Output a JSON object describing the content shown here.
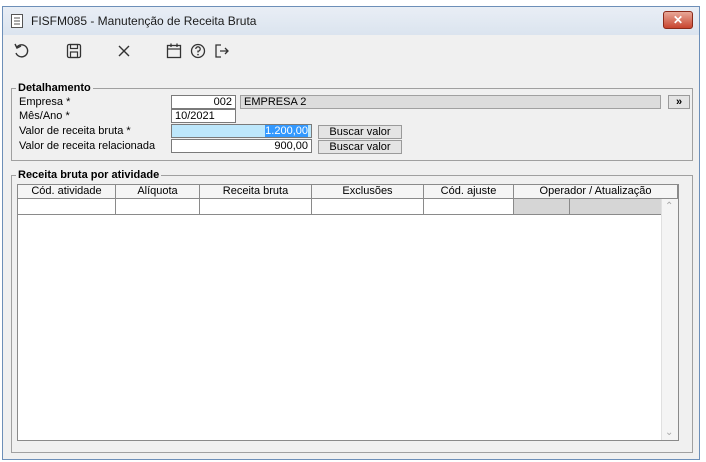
{
  "window": {
    "title": "FISFM085 - Manutenção de Receita Bruta",
    "close_label": "✕"
  },
  "toolbar": {
    "icons": [
      "undo-icon",
      "save-icon",
      "cancel-icon",
      "calendar-icon",
      "help-icon",
      "exit-icon"
    ]
  },
  "detalhamento": {
    "legend": "Detalhamento",
    "empresa_label": "Empresa *",
    "empresa_code": "002",
    "empresa_name": "EMPRESA 2",
    "lookup_label": "»",
    "mes_ano_label": "Mês/Ano *",
    "mes_ano_value": "10/2021",
    "receita_bruta_label": "Valor de receita bruta *",
    "receita_bruta_value": "1.200,00",
    "receita_relacionada_label": "Valor de receita relacionada",
    "receita_relacionada_value": "900,00",
    "buscar_valor_1": "Buscar valor",
    "buscar_valor_2": "Buscar valor"
  },
  "receita_atividade": {
    "legend": "Receita bruta por atividade",
    "columns": [
      "Cód. atividade",
      "Alíquota",
      "Receita bruta",
      "Exclusões",
      "Cód. ajuste",
      "Operador / Atualização"
    ]
  },
  "colors": {
    "selected_field": "#bde7fb",
    "selection": "#3399ff",
    "close_button": "#c8452f"
  }
}
